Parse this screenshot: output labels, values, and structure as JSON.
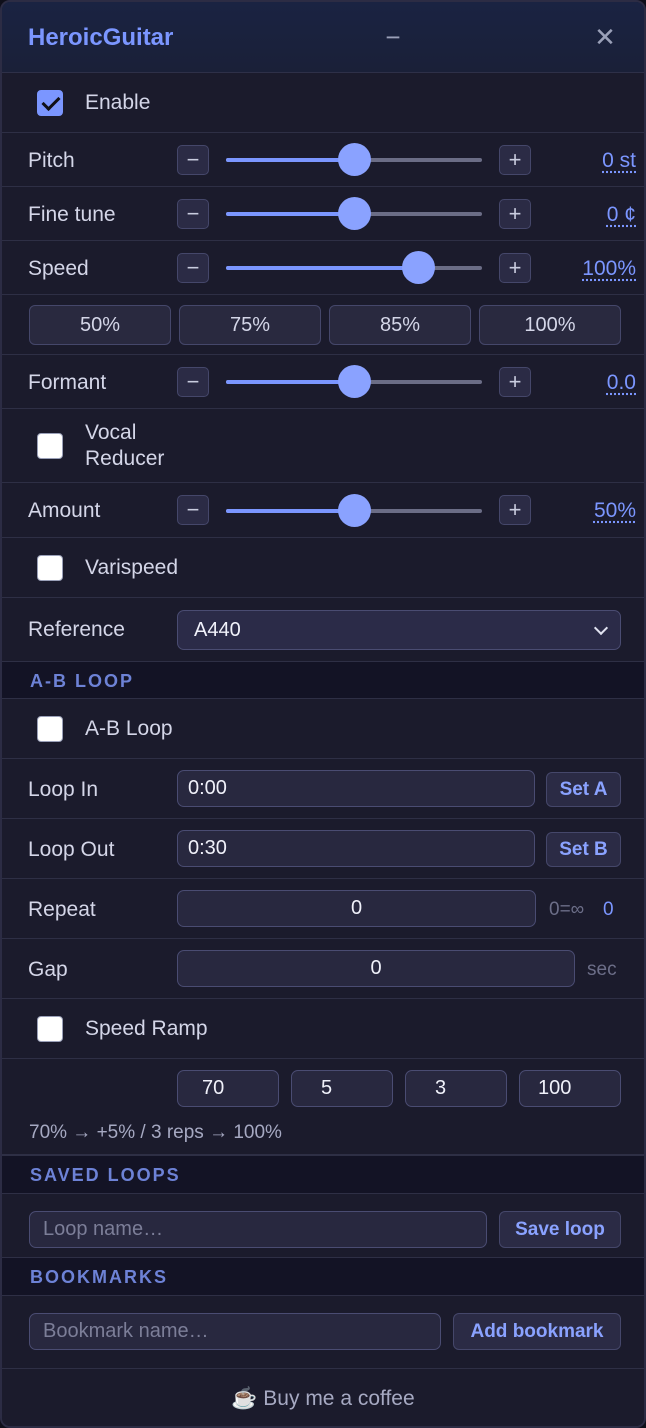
{
  "app": {
    "title": "HeroicGuitar",
    "minimize_glyph": "−",
    "close_glyph": "✕"
  },
  "enable": {
    "label": "Enable",
    "checked": true
  },
  "pitch": {
    "label": "Pitch",
    "value": "0 st",
    "position_fraction": 0.5
  },
  "fine_tune": {
    "label": "Fine tune",
    "value": "0 ¢",
    "position_fraction": 0.5
  },
  "speed": {
    "label": "Speed",
    "value": "100%",
    "position_fraction": 0.75
  },
  "speed_presets": [
    "50%",
    "75%",
    "85%",
    "100%"
  ],
  "formant": {
    "label": "Formant",
    "value": "0.0",
    "position_fraction": 0.5
  },
  "vocal_reducer": {
    "label_line1": "Vocal",
    "label_line2": "Reducer",
    "checked": false
  },
  "amount": {
    "label": "Amount",
    "value": "50%",
    "position_fraction": 0.5
  },
  "varispeed": {
    "label": "Varispeed",
    "checked": false
  },
  "reference": {
    "label": "Reference",
    "selected": "A440"
  },
  "stepper": {
    "minus": "−",
    "plus": "+"
  },
  "ab_section": {
    "title": "A-B LOOP"
  },
  "ab_loop": {
    "label": "A-B Loop",
    "checked": false
  },
  "loop_in": {
    "label": "Loop In",
    "value": "0:00",
    "button": "Set A"
  },
  "loop_out": {
    "label": "Loop Out",
    "value": "0:30",
    "button": "Set B"
  },
  "repeat": {
    "label": "Repeat",
    "value": "0",
    "hint": "0=∞",
    "count": "0"
  },
  "gap": {
    "label": "Gap",
    "value": "0",
    "unit": "sec"
  },
  "speed_ramp": {
    "label": "Speed Ramp",
    "checked": false,
    "start": "70",
    "step": "5",
    "reps": "3",
    "end": "100",
    "summary": "70% → +5% / 3 reps → 100%"
  },
  "saved_loops": {
    "title": "SAVED LOOPS",
    "placeholder": "Loop name…",
    "button": "Save loop"
  },
  "bookmarks": {
    "title": "BOOKMARKS",
    "placeholder": "Bookmark name…",
    "button": "Add bookmark"
  },
  "footer": {
    "coffee": "☕ Buy me a coffee"
  },
  "colors": {
    "accent": "#7b96ff",
    "panel": "#1b1b2c",
    "section": "#131325"
  },
  "icons": {
    "minimize": "minimize-icon",
    "close": "close-icon",
    "chevron": "chevron-down-icon",
    "check": "checkmark-icon"
  }
}
